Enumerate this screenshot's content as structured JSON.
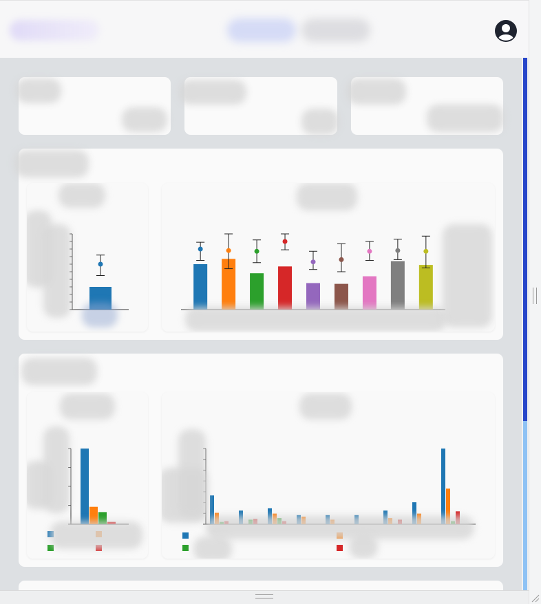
{
  "header": {
    "user_icon": "user-circle-icon"
  },
  "colors": {
    "thumb": "#2746c9",
    "track": "#8ec2f4",
    "palette": [
      "#1f77b4",
      "#ff7f0e",
      "#2ca02c",
      "#d62728",
      "#9467bd",
      "#8c564b",
      "#e377c2",
      "#7f7f7f",
      "#bcbd22"
    ]
  },
  "chart_data": [
    {
      "type": "bar",
      "categories": [
        ""
      ],
      "values": [
        3
      ],
      "error_center": [
        6
      ],
      "error_low": [
        4.5
      ],
      "error_high": [
        7.2
      ],
      "ylim": [
        0,
        10
      ],
      "grid": false,
      "colors": [
        "#1f77b4"
      ]
    },
    {
      "type": "bar",
      "categories": [
        "",
        "",
        "",
        "",
        "",
        "",
        "",
        "",
        ""
      ],
      "values": [
        6,
        6.7,
        4.8,
        5.7,
        3.5,
        3.4,
        4.4,
        6.4,
        5.9
      ],
      "error_center": [
        8,
        7.8,
        7.7,
        9,
        6.3,
        6.6,
        7.7,
        7.8,
        7.7
      ],
      "error_low": [
        6.5,
        5.4,
        6.2,
        7.9,
        5.3,
        5.0,
        6.5,
        6.6,
        5.5
      ],
      "error_high": [
        8.9,
        10,
        9.2,
        10,
        7.7,
        8.7,
        9.0,
        9.3,
        9.7
      ],
      "ylim": [
        0,
        10
      ],
      "grid": false,
      "colors": [
        "#1f77b4",
        "#ff7f0e",
        "#2ca02c",
        "#d62728",
        "#9467bd",
        "#8c564b",
        "#e377c2",
        "#7f7f7f",
        "#bcbd22"
      ]
    },
    {
      "type": "bar",
      "categories": [
        ""
      ],
      "series": [
        {
          "values": [
            100
          ]
        },
        {
          "values": [
            23
          ]
        },
        {
          "values": [
            16
          ]
        },
        {
          "values": [
            3
          ]
        }
      ],
      "ylim": [
        0,
        100
      ],
      "legend": "bottom",
      "grid": false
    },
    {
      "type": "bar",
      "categories": [
        "",
        "",
        "",
        "",
        "",
        "",
        "",
        "",
        ""
      ],
      "series": [
        {
          "values": [
            38,
            18,
            21,
            12,
            12,
            12,
            18,
            29,
            100
          ]
        },
        {
          "values": [
            15,
            0,
            14,
            10,
            6,
            0,
            8,
            14,
            47
          ]
        },
        {
          "values": [
            3,
            6,
            8,
            0,
            0,
            0,
            0,
            0,
            4
          ]
        },
        {
          "values": [
            4,
            7,
            4,
            0,
            0,
            0,
            6,
            0,
            17
          ]
        }
      ],
      "ylim": [
        0,
        100
      ],
      "legend": "bottom",
      "grid": false
    }
  ]
}
